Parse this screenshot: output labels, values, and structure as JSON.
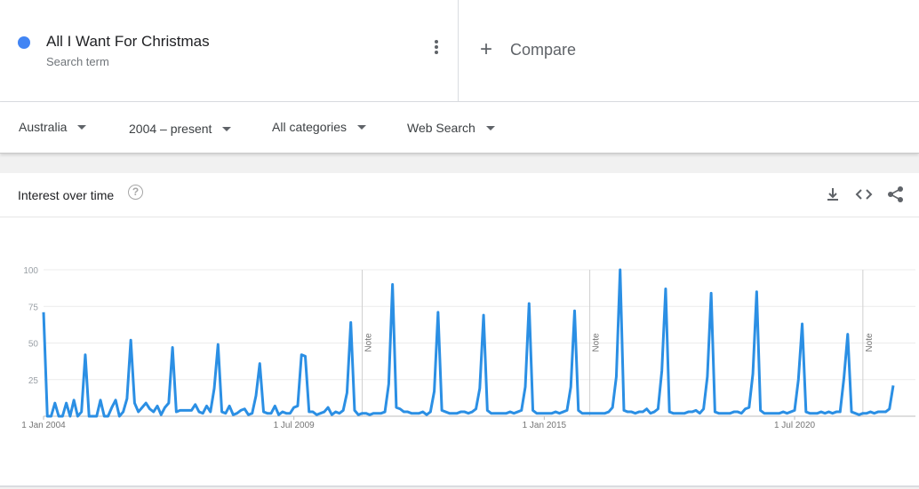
{
  "search_term": {
    "name": "All I Want For Christmas",
    "sub": "Search term",
    "color": "#4285f4"
  },
  "compare": {
    "plus": "+",
    "label": "Compare"
  },
  "filters": [
    {
      "label": "Australia"
    },
    {
      "label": "2004 – present"
    },
    {
      "label": "All categories"
    },
    {
      "label": "Web Search"
    }
  ],
  "card": {
    "title": "Interest over time",
    "help": "?"
  },
  "icons": {
    "download": "download-icon",
    "embed": "embed-code-icon",
    "share": "share-icon"
  },
  "chart_data": {
    "type": "line",
    "ylim": [
      0,
      100
    ],
    "y_ticks": [
      100,
      75,
      50,
      25
    ],
    "x_tick_labels": [
      "1 Jan 2004",
      "1 Jul 2009",
      "1 Jan 2015",
      "1 Jul 2020"
    ],
    "x_tick_months": [
      0,
      66,
      132,
      198
    ],
    "notes": [
      {
        "label": "Note",
        "month": 84
      },
      {
        "label": "Note",
        "month": 144
      },
      {
        "label": "Note",
        "month": 216
      }
    ],
    "line_color": "#2b8fe4",
    "values": [
      71,
      0,
      0,
      9,
      0,
      0,
      9,
      0,
      11,
      0,
      3,
      42,
      0,
      0,
      0,
      11,
      0,
      0,
      6,
      11,
      0,
      3,
      12,
      52,
      9,
      3,
      6,
      9,
      5,
      3,
      7,
      1,
      6,
      9,
      47,
      3,
      4,
      4,
      4,
      4,
      8,
      3,
      2,
      7,
      3,
      19,
      49,
      3,
      2,
      7,
      1,
      2,
      4,
      5,
      1,
      2,
      14,
      36,
      3,
      2,
      2,
      7,
      1,
      3,
      2,
      2,
      6,
      7,
      42,
      41,
      3,
      3,
      1,
      2,
      3,
      6,
      1,
      3,
      2,
      4,
      16,
      64,
      4,
      1,
      2,
      2,
      1,
      2,
      2,
      2,
      3,
      22,
      90,
      6,
      5,
      3,
      3,
      2,
      2,
      2,
      3,
      1,
      3,
      17,
      71,
      4,
      3,
      2,
      2,
      2,
      3,
      3,
      2,
      3,
      5,
      19,
      69,
      4,
      2,
      2,
      2,
      2,
      2,
      3,
      2,
      3,
      4,
      20,
      77,
      4,
      2,
      2,
      2,
      2,
      2,
      3,
      2,
      3,
      4,
      20,
      72,
      4,
      2,
      2,
      2,
      2,
      2,
      2,
      2,
      3,
      6,
      27,
      100,
      4,
      3,
      3,
      2,
      3,
      3,
      5,
      2,
      3,
      5,
      31,
      87,
      3,
      2,
      2,
      2,
      2,
      3,
      3,
      4,
      2,
      5,
      27,
      84,
      3,
      2,
      2,
      2,
      2,
      3,
      3,
      2,
      5,
      6,
      29,
      85,
      4,
      2,
      2,
      2,
      2,
      2,
      3,
      2,
      3,
      4,
      25,
      63,
      3,
      2,
      2,
      2,
      3,
      2,
      3,
      2,
      3,
      3,
      26,
      56,
      3,
      2,
      1,
      2,
      2,
      3,
      2,
      3,
      3,
      3,
      5,
      21
    ]
  }
}
